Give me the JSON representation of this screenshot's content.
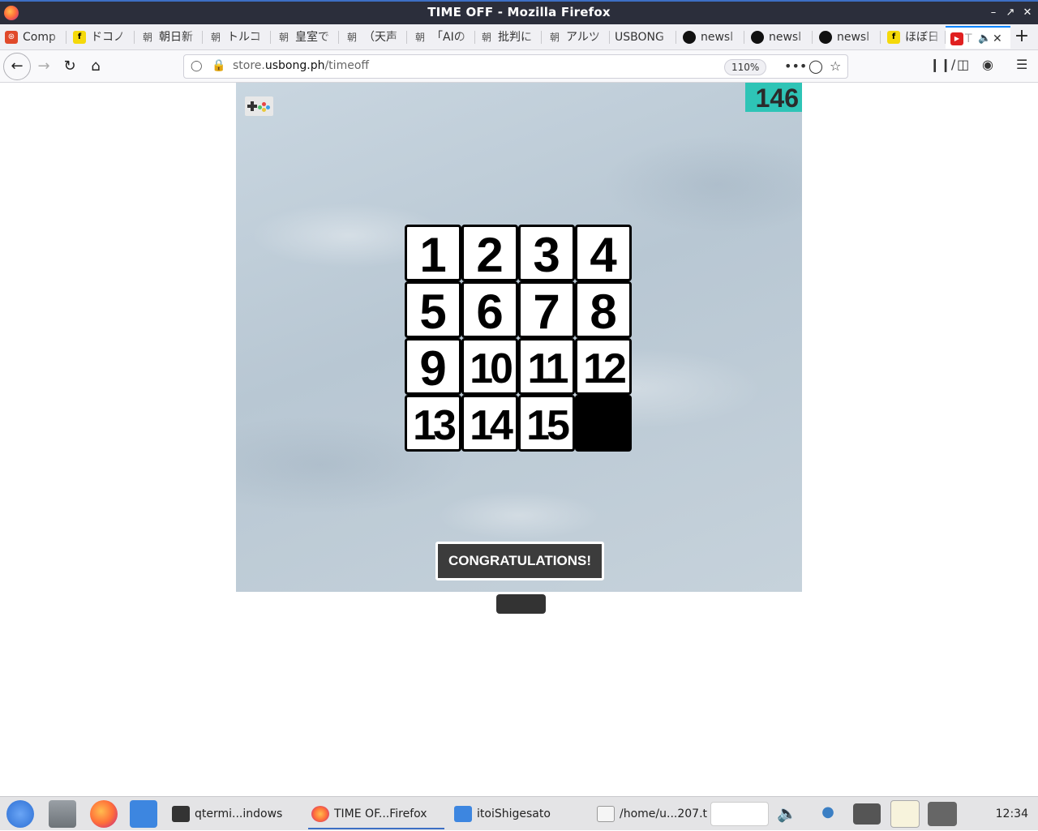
{
  "window": {
    "title": "TIME OFF - Mozilla Firefox",
    "app_icon": "firefox-icon"
  },
  "tabs": [
    {
      "label": "Comp",
      "icon": "x-icon",
      "color": "#e0492a"
    },
    {
      "label": "ドコノ",
      "icon": "f-icon",
      "color": "#f5d90a"
    },
    {
      "label": "朝日新",
      "icon": "kanji-icon",
      "color": "#555555"
    },
    {
      "label": "トルコ",
      "icon": "kanji-icon",
      "color": "#555555"
    },
    {
      "label": "皇室で",
      "icon": "kanji-icon",
      "color": "#555555"
    },
    {
      "label": "（天声",
      "icon": "kanji-icon",
      "color": "#555555"
    },
    {
      "label": "「AIの",
      "icon": "kanji-icon",
      "color": "#555555"
    },
    {
      "label": "批判に",
      "icon": "kanji-icon",
      "color": "#555555"
    },
    {
      "label": "アルツ",
      "icon": "kanji-icon",
      "color": "#555555"
    },
    {
      "label": "USBONG",
      "icon": "",
      "color": ""
    },
    {
      "label": "newsl",
      "icon": "github-icon",
      "color": "#111111"
    },
    {
      "label": "newsl",
      "icon": "github-icon",
      "color": "#111111"
    },
    {
      "label": "newsl",
      "icon": "github-icon",
      "color": "#111111"
    },
    {
      "label": "ほぼ日",
      "icon": "f-icon",
      "color": "#f5d90a"
    },
    {
      "label": "T",
      "icon": "youtube-icon",
      "color": "#e02020"
    }
  ],
  "nav": {
    "url_domain_prefix": "store.",
    "url_domain": "usbong.ph",
    "url_path": "/timeoff",
    "zoom": "110%"
  },
  "game": {
    "score": "146",
    "tiles": [
      "1",
      "2",
      "3",
      "4",
      "5",
      "6",
      "7",
      "8",
      "9",
      "10",
      "11",
      "12",
      "13",
      "14",
      "15",
      ""
    ],
    "message": "CONGRATULATIONS!"
  },
  "taskbar": {
    "tasks": [
      "qtermi...indows",
      "TIME OF...Firefox",
      "itoiShigesato",
      "/home/u...207.t"
    ],
    "clock": "12:34"
  }
}
